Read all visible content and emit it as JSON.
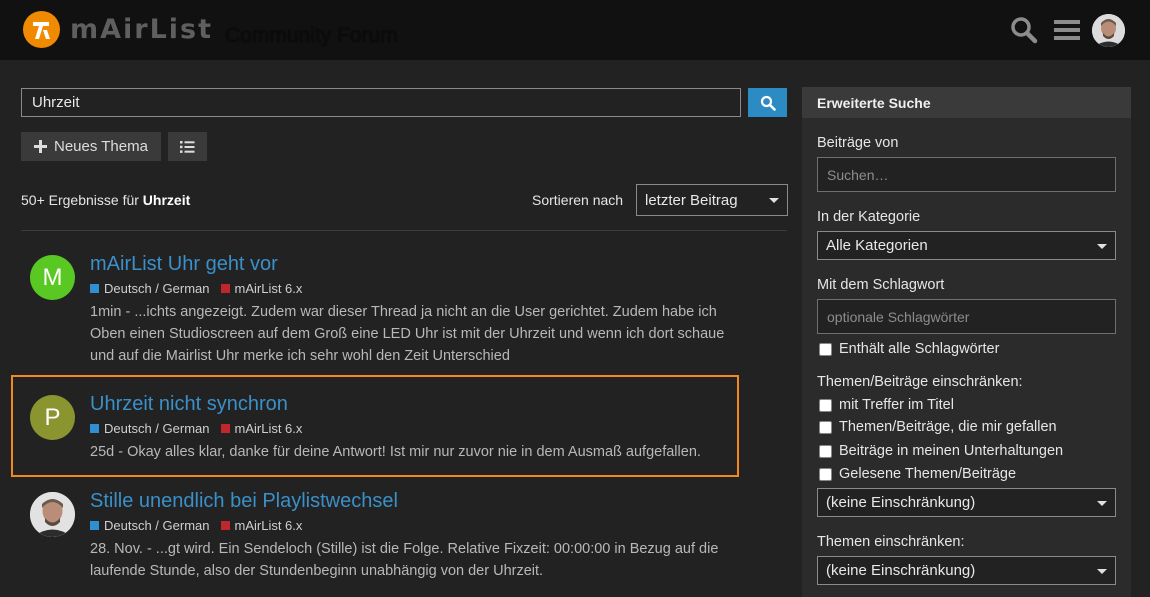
{
  "header": {
    "logo_text": "mAirList",
    "forum_title": "Community Forum"
  },
  "search": {
    "query": "Uhrzeit"
  },
  "toolbar": {
    "new_topic_label": "Neues Thema"
  },
  "results_summary": {
    "prefix": "50+ Ergebnisse für",
    "term": "Uhrzeit",
    "sort_label": "Sortieren nach",
    "sort_value": "letzter Beitrag"
  },
  "results": [
    {
      "avatar_letter": "M",
      "avatar_color": "#5ac822",
      "title": "mAirList Uhr geht vor",
      "category": "Deutsch / German",
      "category_color": "#2f8fd0",
      "tag": "mAirList 6.x",
      "tag_color": "#c0262c",
      "blurb": "1min - ...ichts angezeigt. Zudem war dieser Thread ja nicht an die User gerichtet. Zudem habe ich Oben einen Studioscreen auf dem Groß eine LED Uhr ist mit der Uhrzeit und wenn ich dort schaue und auf die Mairlist Uhr merke ich sehr wohl den Zeit Unterschied"
    },
    {
      "avatar_letter": "P",
      "avatar_color": "#8a9530",
      "title": "Uhrzeit nicht synchron",
      "category": "Deutsch / German",
      "category_color": "#2f8fd0",
      "tag": "mAirList 6.x",
      "tag_color": "#c0262c",
      "blurb": "25d - Okay alles klar, danke für deine Antwort! Ist mir nur zuvor nie in dem Ausmaß aufgefallen."
    },
    {
      "avatar_letter": "",
      "avatar_color": "#e0e0e0",
      "title": "Stille unendlich bei Playlistwechsel",
      "category": "Deutsch / German",
      "category_color": "#2f8fd0",
      "tag": "mAirList 6.x",
      "tag_color": "#c0262c",
      "blurb": "28. Nov. - ...gt wird. Ein Sendeloch (Stille) ist die Folge. Relative Fixzeit: 00:00:00 in Bezug auf die laufende Stunde, also der Stundenbeginn unabhängig von der Uhrzeit."
    }
  ],
  "advanced": {
    "heading": "Erweiterte Suche",
    "posts_by_label": "Beiträge von",
    "posts_by_placeholder": "Suchen…",
    "category_label": "In der Kategorie",
    "category_value": "Alle Kategorien",
    "tag_label": "Mit dem Schlagwort",
    "tag_placeholder": "optionale Schlagwörter",
    "all_tags_label": "Enthält alle Schlagwörter",
    "restrict_label": "Themen/Beiträge einschränken:",
    "restrict_options": [
      "mit Treffer im Titel",
      "Themen/Beiträge, die mir gefallen",
      "Beiträge in meinen Unterhaltungen",
      "Gelesene Themen/Beiträge"
    ],
    "restrict_select_value": "(keine Einschränkung)",
    "topics_restrict_label": "Themen einschränken:",
    "topics_restrict_value": "(keine Einschränkung)"
  },
  "colors": {
    "accent": "#2c8bc2",
    "logo_orange": "#f08a00",
    "highlight_outline": "#f08a1c"
  }
}
